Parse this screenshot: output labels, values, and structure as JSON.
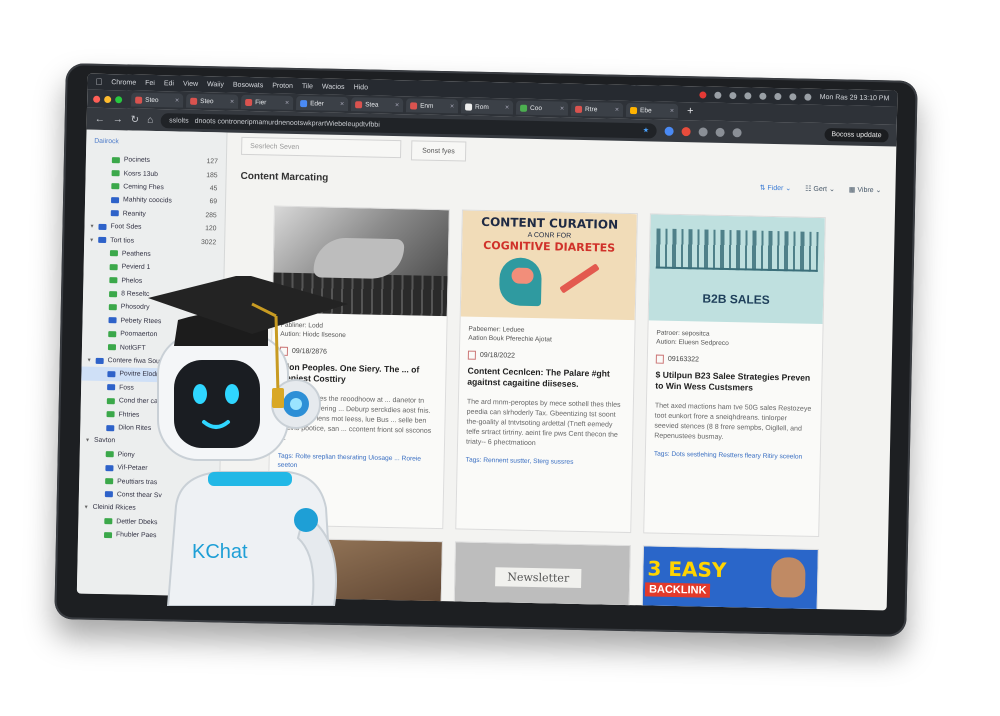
{
  "menubar": {
    "items": [
      "Chrome",
      "Fei",
      "Edi",
      "View",
      "Waiiy",
      "Bosowats",
      "Proton",
      "Tile",
      "Wacios",
      "Hido"
    ],
    "clock": "Mon Ras 29  13:10 PM"
  },
  "tabs": [
    {
      "label": "Steo"
    },
    {
      "label": "Steo"
    },
    {
      "label": "Fier"
    },
    {
      "label": "Eder"
    },
    {
      "label": "Stea"
    },
    {
      "label": "Enm"
    },
    {
      "label": "Rom"
    },
    {
      "label": "Coo"
    },
    {
      "label": "Rtre"
    },
    {
      "label": "Ebe"
    }
  ],
  "toolbar": {
    "url": "dnoots controneripmamurdnenootswkprartWiebeleupdtvfbbi",
    "url_prefix": "sslolts",
    "update_label": "Bocoss upddate"
  },
  "sidebar": {
    "header": "Daiirock",
    "items": [
      {
        "label": "Pocinets",
        "count": "127",
        "color": "#3ba84a",
        "indent": 2
      },
      {
        "label": "Kosrs 13ub",
        "count": "185",
        "color": "#3ba84a",
        "indent": 2
      },
      {
        "label": "Ceming Fhes",
        "count": "45",
        "color": "#3ba84a",
        "indent": 2
      },
      {
        "label": "Mahhity coocids",
        "count": "69",
        "color": "#2e62c9",
        "indent": 2
      },
      {
        "label": "Reanity",
        "count": "285",
        "color": "#2e62c9",
        "indent": 2
      },
      {
        "label": "Foot Sdes",
        "count": "120",
        "color": "#2e62c9",
        "indent": 1
      },
      {
        "label": "Tort tios",
        "count": "3022",
        "color": "#2e62c9",
        "indent": 1
      },
      {
        "label": "Peathens",
        "count": "",
        "color": "#3ba84a",
        "indent": 2
      },
      {
        "label": "Pevierd 1",
        "count": "",
        "color": "#3ba84a",
        "indent": 2
      },
      {
        "label": "Phelos",
        "count": "",
        "color": "#3ba84a",
        "indent": 2
      },
      {
        "label": "8 Reseltc",
        "count": "",
        "color": "#3ba84a",
        "indent": 2
      },
      {
        "label": "Phosodry",
        "count": "",
        "color": "#3ba84a",
        "indent": 2
      },
      {
        "label": "Pebety Rtees",
        "count": "",
        "color": "#2e62c9",
        "indent": 2
      },
      {
        "label": "Poomaerton",
        "count": "",
        "color": "#3ba84a",
        "indent": 2
      },
      {
        "label": "NotlGFT",
        "count": "",
        "color": "#3ba84a",
        "indent": 2
      },
      {
        "label": "Contere fiwa Sou",
        "count": "",
        "color": "#2e62c9",
        "indent": 1
      },
      {
        "label": "Povitre Elodr",
        "count": "",
        "color": "#2e62c9",
        "indent": 2,
        "selected": true
      },
      {
        "label": "Foss",
        "count": "",
        "color": "#2e62c9",
        "indent": 2
      },
      {
        "label": "Cond ther cac",
        "count": "",
        "color": "#3ba84a",
        "indent": 2
      },
      {
        "label": "Fhtries",
        "count": "",
        "color": "#3ba84a",
        "indent": 2
      },
      {
        "label": "Dilon Rites",
        "count": "",
        "color": "#2e62c9",
        "indent": 2
      },
      {
        "label": "Savton",
        "count": "",
        "color": "",
        "indent": 1
      },
      {
        "label": "Piony",
        "count": "",
        "color": "#3ba84a",
        "indent": 2
      },
      {
        "label": "Vif-Petaer",
        "count": "",
        "color": "#2e62c9",
        "indent": 2
      },
      {
        "label": "Peuttiars tras",
        "count": "",
        "color": "#3ba84a",
        "indent": 2
      },
      {
        "label": "Const thear Sv",
        "count": "",
        "color": "#2e62c9",
        "indent": 2
      },
      {
        "label": "Cleinid Rkices",
        "count": "",
        "color": "",
        "indent": 1
      },
      {
        "label": "Dettler Dbeks",
        "count": "",
        "color": "#3ba84a",
        "indent": 2
      },
      {
        "label": "Fhubler Paes",
        "count": "",
        "color": "#3ba84a",
        "indent": 2
      }
    ]
  },
  "search": {
    "placeholder": "Sesrlech Seven",
    "sort_label": "Sonst fyes"
  },
  "page": {
    "title": "Content Marcating",
    "filter_label": "Fider",
    "sort_label": "Gert",
    "view_label": "Vibre"
  },
  "cards": [
    {
      "publisher": "Pabliner: Lodd",
      "author": "Aution: Hiodc Ilsesone",
      "date": "09/18/2876",
      "title": "...ion Peoples. One Siery. The ... of Geniest Costtiry",
      "excerpt": "Stre thoontores the reoodhoow at ... danetor tn mmering, covering ... Deburp serckdies aost fnis. ... hecamns lens mot leess, lue Bus ... selle ben threins pootice, san ... ccontent friont sol ssconos to.",
      "tags": "Tags: Rolte sreplian thesrating Uiosage ... Roreie seeton"
    },
    {
      "thumb_title": "CONTENT CURATION",
      "thumb_sub": "A CONR FOR",
      "thumb_title2": "COGNITIVE DIARETES",
      "publisher": "Pabeemer: Leduee",
      "author": "Aation Bouk Pferechie Ajotat",
      "date": "09/18/2022",
      "title": "Content Cecnlcen: The Palare #ght agaitnst cagaitine diiseses.",
      "excerpt": "The ard mnm-peroptes by mece sothell thes thles peedia can slrhoderly Tax. Gbeentizing tst soont the-goality al tntvtsoting ardettal (Tneft eemedy telfe srtract tirtriny. aeint fire pws Cent thecon the triaty-- 6 phectmatioon",
      "tags": "Tags: Rennent sustter, Sterg sussres"
    },
    {
      "thumb_title": "B2B SALES",
      "publisher": "Patroer: sepositca",
      "author": "Aution: Eluesn Sedpreco",
      "date": "09163322",
      "title": "$ Utilpun B23 Salee Strategies Preven to Win Wess Custsmers",
      "excerpt": "Thet axed mactions ham tve 50G sales Restozeye toot eunkort frore a sneiqhdreans. tinlorper seevied stences (8 8 frere sempbs, Oigllell, and Repenustees busmay.",
      "tags": "Tags: Dots sestlehing Restters fleary Ritiry sceelon"
    }
  ],
  "bottom_cards": [
    {
      "label": ""
    },
    {
      "label": "Newsletter"
    },
    {
      "label": "3 EASY",
      "label2": "BACKLINK"
    }
  ],
  "robot": {
    "chest_label": "KChat"
  }
}
